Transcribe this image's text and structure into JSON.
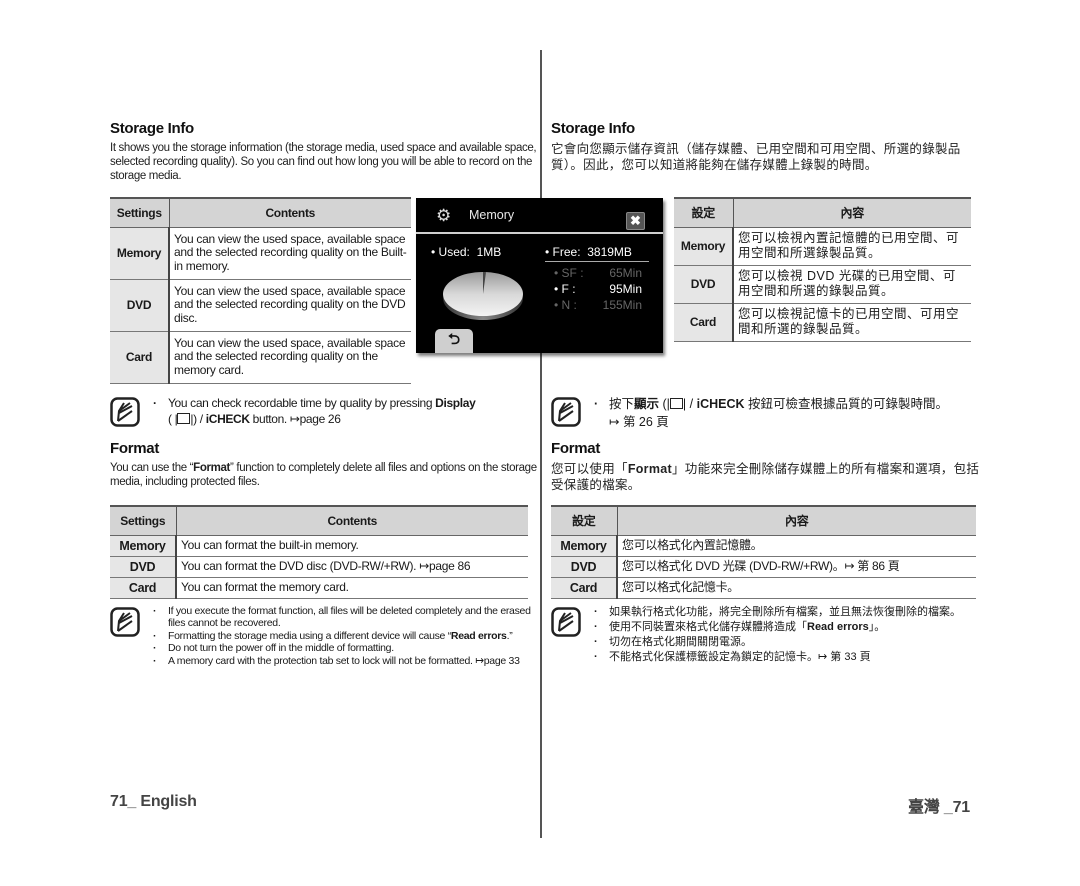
{
  "left": {
    "storage_info": {
      "title": "Storage Info",
      "intro": "It shows you the storage information (the storage media, used space and available space, selected recording quality). So you can find out how long you will be able to record on the storage media.",
      "table": {
        "headers": [
          "Settings",
          "Contents"
        ],
        "rows": [
          {
            "setting": "Memory",
            "content": "You can view the used space, available space and the selected recording quality on the Built-in memory."
          },
          {
            "setting": "DVD",
            "content": "You can view the used space, available space and the selected recording quality on the DVD disc."
          },
          {
            "setting": "Card",
            "content": "You can view the used space, available space and the selected recording quality on the memory card."
          }
        ]
      },
      "note": {
        "prefix": "You can check recordable time by quality by pressing ",
        "bold": "Display",
        "mid": " ( |",
        "mid2": "|) / ",
        "icheck": "iCHECK",
        "suffix": " button. ↦page 26"
      }
    },
    "format": {
      "title": "Format",
      "intro_prefix": "You can use the “",
      "intro_bold": "Format",
      "intro_suffix": "” function to completely delete all files and options on the storage media, including protected files.",
      "table": {
        "headers": [
          "Settings",
          "Contents"
        ],
        "rows": [
          {
            "setting": "Memory",
            "content": "You can format the built-in memory."
          },
          {
            "setting": "DVD",
            "content": "You can format the DVD disc (DVD-RW/+RW). ↦page 86"
          },
          {
            "setting": "Card",
            "content": "You can format the memory card."
          }
        ]
      },
      "notes": [
        "If you execute the format function, all files will be deleted completely and the erased files cannot be recovered.",
        "Formatting the storage media using a different device will cause “",
        "Do not turn the power off in the middle of formatting.",
        "A memory card with the protection tab set to lock will not be formatted. ↦page 33"
      ],
      "note2_bold": "Read errors",
      "note2_suffix": ".”"
    },
    "footer": "71_ English"
  },
  "lcd": {
    "title": "Memory",
    "close_label": "✖",
    "used_label": "• Used:",
    "used_value": "1MB",
    "free_label": "• Free:",
    "free_value": "3819MB",
    "used_fraction": 0.0003,
    "qualities": [
      {
        "label": "• SF :",
        "value": "65Min",
        "selected": false
      },
      {
        "label": "• F   :",
        "value": "95Min",
        "selected": true
      },
      {
        "label": "• N   :",
        "value": "155Min",
        "selected": false
      }
    ],
    "back_label": "⮌"
  },
  "right": {
    "storage_info": {
      "title": "Storage Info",
      "intro": "它會向您顯示儲存資訊（儲存媒體、已用空間和可用空間、所選的錄製品質）。因此，您可以知道將能夠在儲存媒體上錄製的時間。",
      "table": {
        "headers": [
          "設定",
          "內容"
        ],
        "rows": [
          {
            "setting": "Memory",
            "content": "您可以檢視內置記憶體的已用空間、可用空間和所選錄製品質。"
          },
          {
            "setting": "DVD",
            "content": "您可以檢視 DVD 光碟的已用空間、可用空間和所選的錄製品質。"
          },
          {
            "setting": "Card",
            "content": "您可以檢視記憶卡的已用空間、可用空間和所選的錄製品質。"
          }
        ]
      },
      "note": {
        "prefix": "按下",
        "bold": "顯示",
        "mid": " (|",
        "mid2": "| / ",
        "icheck": "iCHECK",
        "suffix": " 按鈕可檢查根據品質的可錄製時間。",
        "ref": "↦ 第 26 頁"
      }
    },
    "format": {
      "title": "Format",
      "intro_prefix": "您可以使用「",
      "intro_bold": "Format",
      "intro_suffix": "」功能來完全刪除儲存媒體上的所有檔案和選項，包括受保護的檔案。",
      "table": {
        "headers": [
          "設定",
          "內容"
        ],
        "rows": [
          {
            "setting": "Memory",
            "content": "您可以格式化內置記憶體。"
          },
          {
            "setting": "DVD",
            "content": "您可以格式化 DVD 光碟 (DVD-RW/+RW)。↦ 第 86 頁"
          },
          {
            "setting": "Card",
            "content": "您可以格式化記憶卡。"
          }
        ]
      },
      "notes": [
        "如果執行格式化功能，將完全刪除所有檔案，並且無法恢復刪除的檔案。",
        "使用不同裝置來格式化儲存媒體將造成「",
        "切勿在格式化期間關閉電源。",
        "不能格式化保護標籤設定為鎖定的記憶卡。↦ 第 33 頁"
      ],
      "note2_bold": "Read errors",
      "note2_suffix": "」。"
    },
    "footer": "臺灣 _71"
  }
}
